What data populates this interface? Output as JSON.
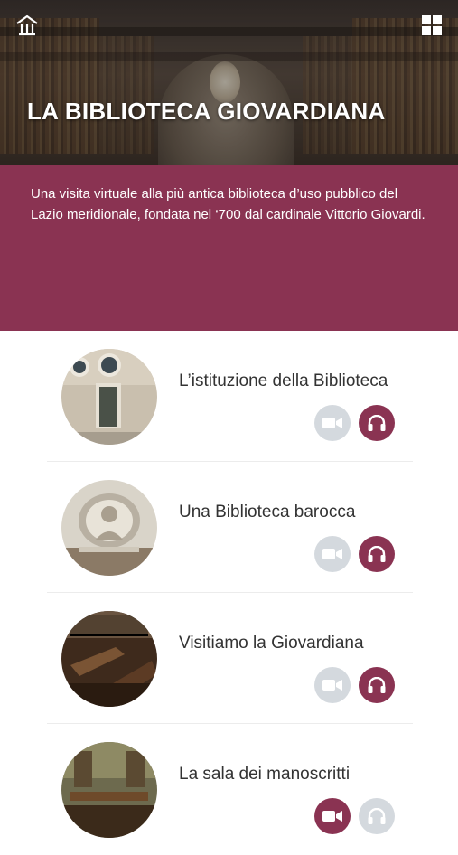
{
  "header": {
    "title": "LA BIBLIOTECA GIOVARDIANA",
    "home_icon": "museum-home-icon",
    "menu_icon": "grid-menu-icon"
  },
  "intro": {
    "text": "Una visita virtuale alla più antica biblioteca d’uso pubblico del Lazio meridionale, fondata nel ‘700 dal cardinale Vittorio Giovardi."
  },
  "items": [
    {
      "title": "L’istituzione della Biblioteca"
    },
    {
      "title": "Una Biblioteca barocca"
    },
    {
      "title": "Visitiamo la Giovardiana"
    },
    {
      "title": "La sala dei manoscritti"
    }
  ],
  "colors": {
    "accent": "#8a3352",
    "button_inactive": "#d4d9de",
    "text": "#333333"
  }
}
